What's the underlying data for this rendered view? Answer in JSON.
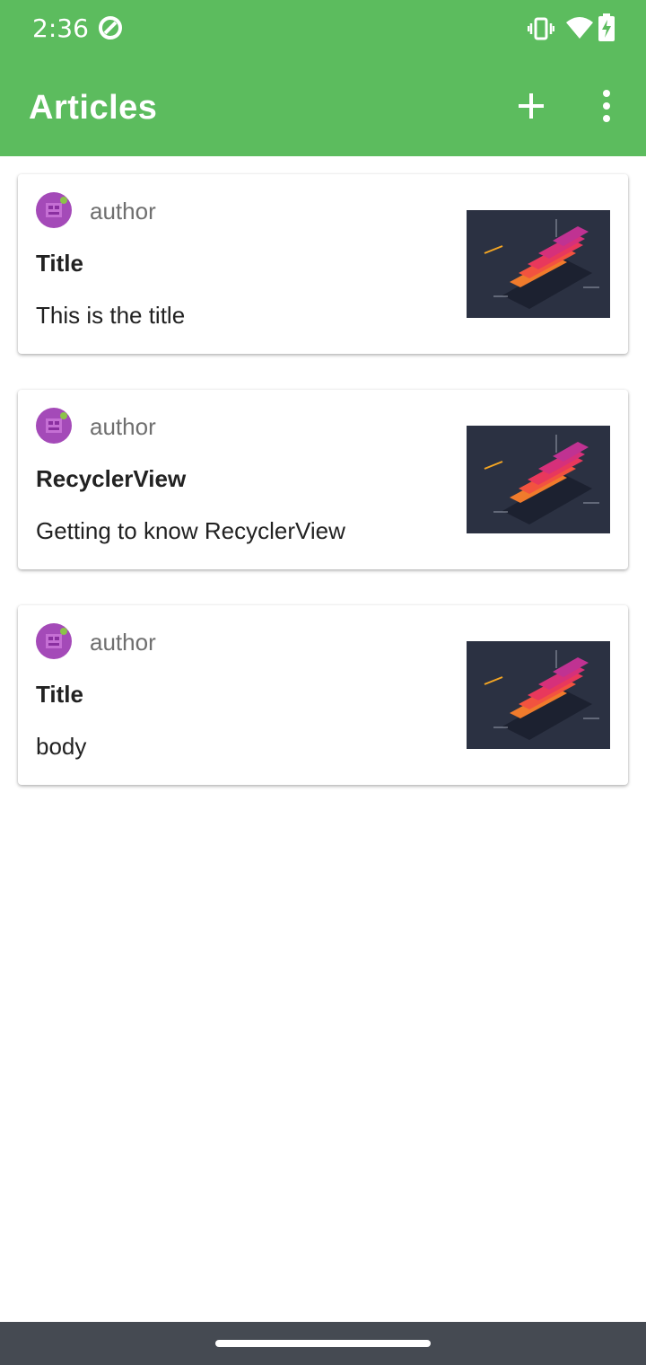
{
  "status_bar": {
    "time": "2:36",
    "icons": [
      "sync-icon",
      "vibrate-icon",
      "wifi-icon",
      "battery-charging-icon"
    ]
  },
  "app_bar": {
    "title": "Articles",
    "actions": [
      "add-icon",
      "more-vert-icon"
    ]
  },
  "articles": [
    {
      "author": "author",
      "title": "Title",
      "body": "This is the title"
    },
    {
      "author": "author",
      "title": "RecyclerView",
      "body": "Getting to know RecyclerView"
    },
    {
      "author": "author",
      "title": "Title",
      "body": "body"
    }
  ],
  "colors": {
    "primary": "#5cbc5e",
    "nav_bar": "#454a52",
    "author_text": "#6f6f6f",
    "avatar": "#a44ab8"
  }
}
